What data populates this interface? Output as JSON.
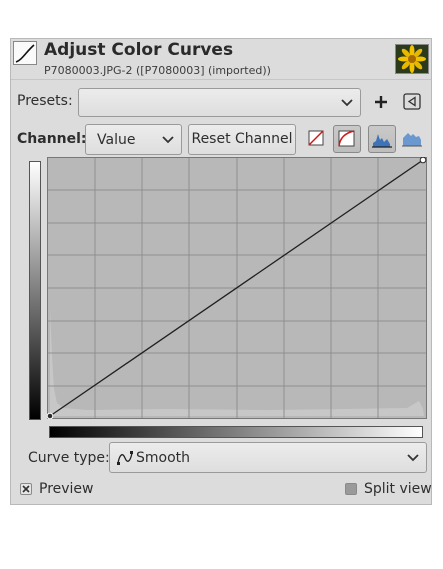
{
  "header": {
    "title": "Adjust Color Curves",
    "subtitle": "P7080003.JPG-2 ([P7080003] (imported))",
    "curve_icon": "curve-icon",
    "thumbnail_icon": "image-thumbnail"
  },
  "presets": {
    "label": "Presets:",
    "value": "",
    "add_icon": "plus-icon",
    "menu_icon": "triangle-left-menu-icon"
  },
  "channel": {
    "label": "Channel:",
    "value": "Value",
    "reset_label": "Reset Channel",
    "linear_icon": "linear-curve-icon",
    "log_icon": "log-curve-icon",
    "hist_linear_icon": "linear-histogram-icon",
    "hist_log_icon": "log-histogram-icon"
  },
  "curve_type": {
    "label": "Curve type:",
    "value": "Smooth",
    "icon": "smooth-curve-icon"
  },
  "preview": {
    "label": "Preview",
    "checked": true
  },
  "split_view": {
    "label": "Split view",
    "checked": false
  },
  "colors": {
    "dialog_bg": "#dcdcdc",
    "graph_bg": "#b7b7b7",
    "grid": "#8f8f8f",
    "curve": "#202020"
  }
}
